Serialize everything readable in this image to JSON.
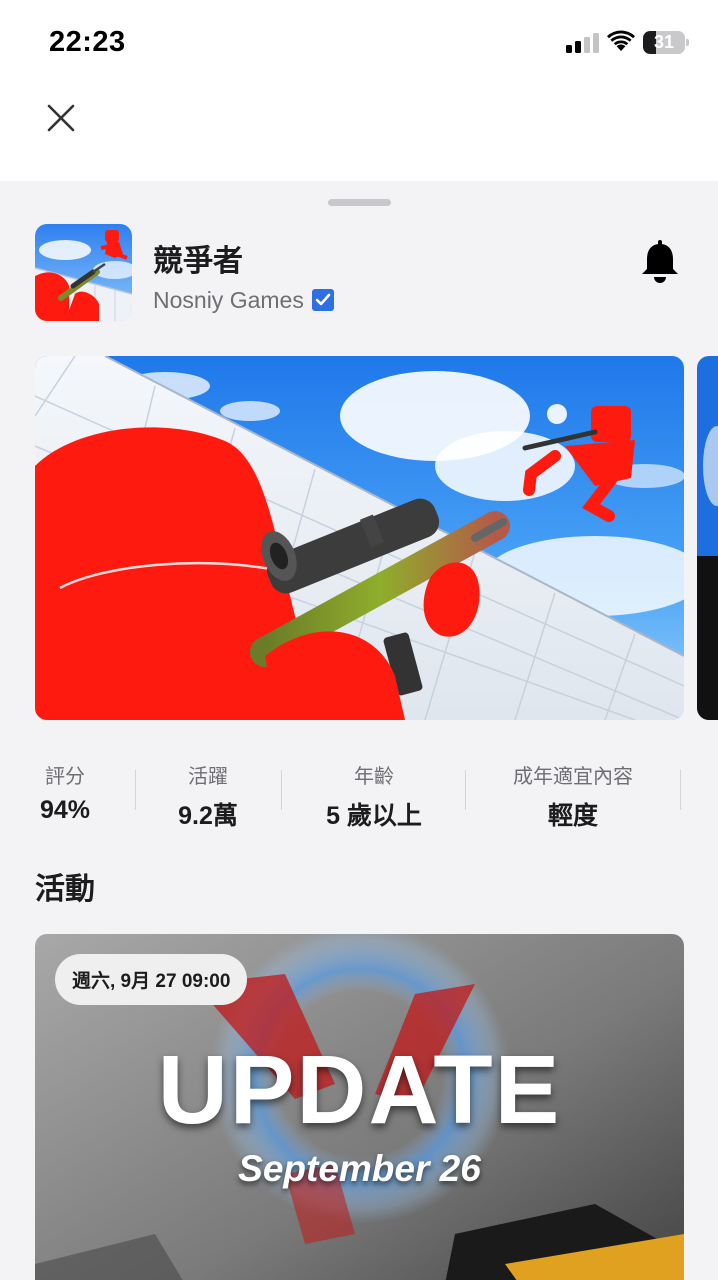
{
  "status_bar": {
    "time": "22:23",
    "battery": "31",
    "battery_level": 0.31,
    "signal_bars_filled": 2,
    "signal_bars_total": 4,
    "icons": [
      "signal-icon",
      "wifi-icon",
      "battery-icon"
    ]
  },
  "header": {
    "close_icon": "close-icon"
  },
  "app": {
    "title": "競爭者",
    "developer": "Nosniy Games",
    "verified_icon": "verified-badge-icon",
    "notify_icon": "bell-icon"
  },
  "stats": [
    {
      "label": "評分",
      "value": "94%"
    },
    {
      "label": "活躍",
      "value": "9.2萬"
    },
    {
      "label": "年齡",
      "value": "5 歲以上"
    },
    {
      "label": "成年適宜內容",
      "value": "輕度"
    }
  ],
  "events": {
    "section_title": "活動",
    "items": [
      {
        "date": "週六, 9月 27 09:00",
        "headline": "UPDATE",
        "subtitle": "September 26"
      }
    ]
  },
  "colors": {
    "sheet_background": "#f3f3f6",
    "accent_red": "#ff1a10",
    "verified_blue": "#2f6fe4",
    "sky_blue": "#2e8cf0"
  }
}
